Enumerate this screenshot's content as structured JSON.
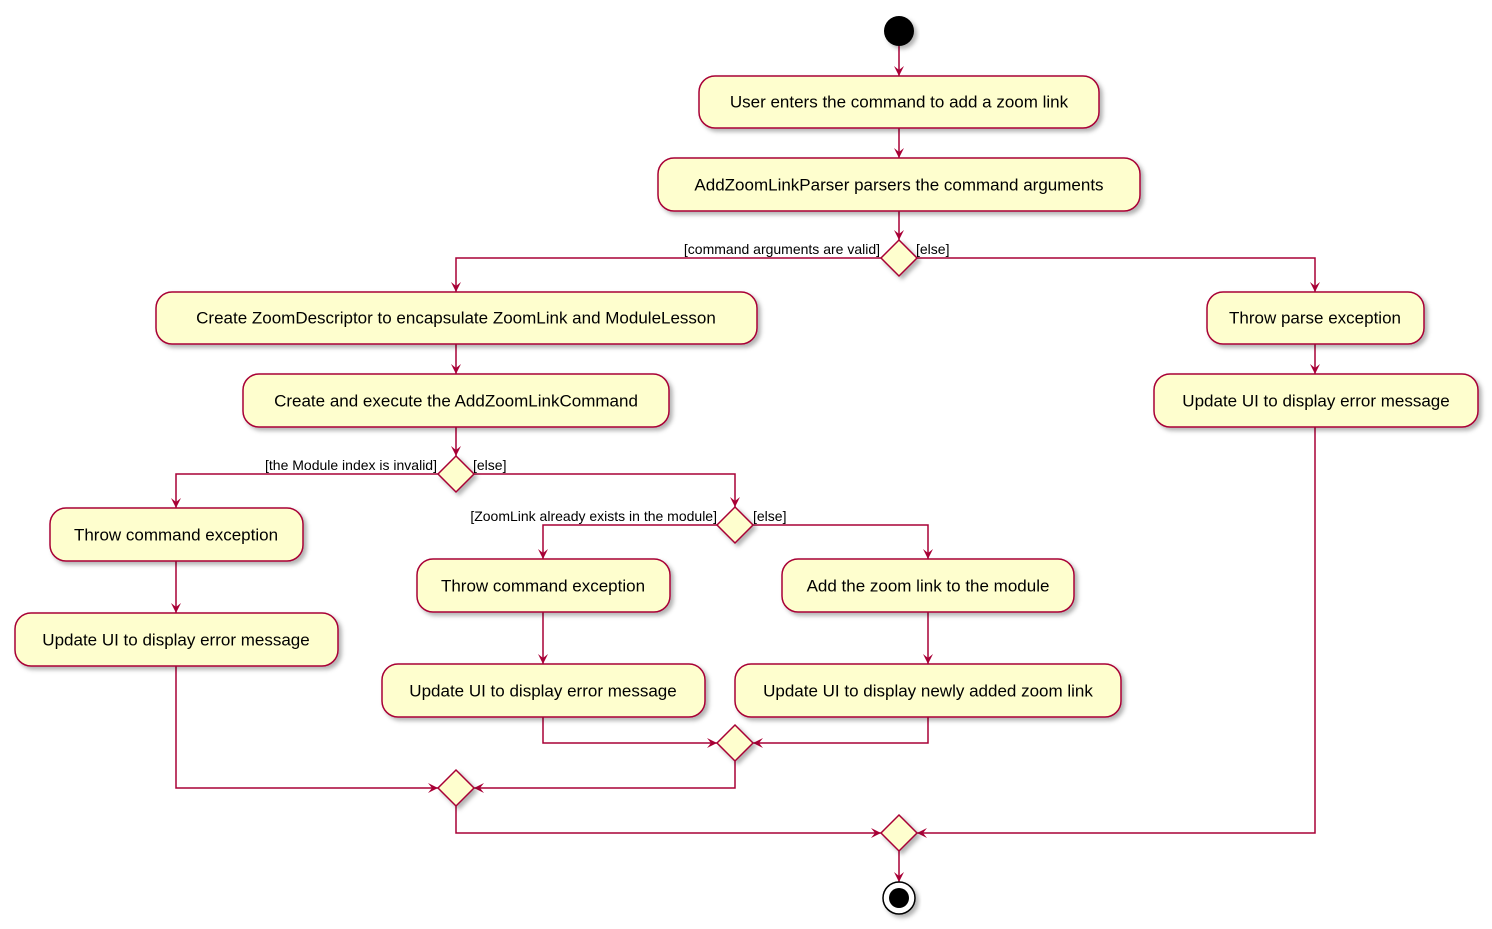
{
  "colors": {
    "node_fill": "#FEFECE",
    "border": "#A80036",
    "start_end": "#000000"
  },
  "nodes": {
    "enter_command": "User enters the command to add a zoom link",
    "parse_args": "AddZoomLinkParser parsers the command arguments",
    "create_descriptor": "Create ZoomDescriptor to encapsulate ZoomLink and ModuleLesson",
    "create_execute": "Create and execute the AddZoomLinkCommand",
    "throw_cmd_1": "Throw command exception",
    "update_err_1": "Update UI to display error message",
    "throw_cmd_2": "Throw command exception",
    "update_err_2": "Update UI to display error message",
    "add_link": "Add the zoom link to the module",
    "update_added": "Update UI to display newly added zoom link",
    "throw_parse": "Throw parse exception",
    "update_err_3": "Update UI to display error message"
  },
  "guards": {
    "args_valid": "[command arguments are valid]",
    "args_else": "[else]",
    "index_invalid": "[the Module index is invalid]",
    "index_else": "[else]",
    "link_exists": "[ZoomLink already exists in the module]",
    "link_else": "[else]"
  }
}
